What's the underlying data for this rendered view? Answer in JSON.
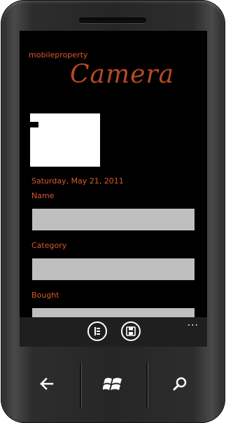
{
  "app": {
    "name": "mobileproperty",
    "page_title": "Camera"
  },
  "details": {
    "date": "Saturday, May 21, 2011",
    "fields": [
      {
        "label": "Name",
        "value": ""
      },
      {
        "label": "Category",
        "value": ""
      },
      {
        "label": "Bought",
        "value": ""
      }
    ]
  },
  "appbar": {
    "buttons": [
      {
        "icon": "list-icon"
      },
      {
        "icon": "save-icon"
      }
    ],
    "menu_dots": "..."
  },
  "hardware_keys": [
    "back-icon",
    "windows-start-icon",
    "search-icon"
  ],
  "colors": {
    "accent": "#d85a2a",
    "title": "#b74a23",
    "field_bg": "#bfbfbf",
    "screen_bg": "#000000",
    "appbar_bg": "#1f1f1f"
  }
}
